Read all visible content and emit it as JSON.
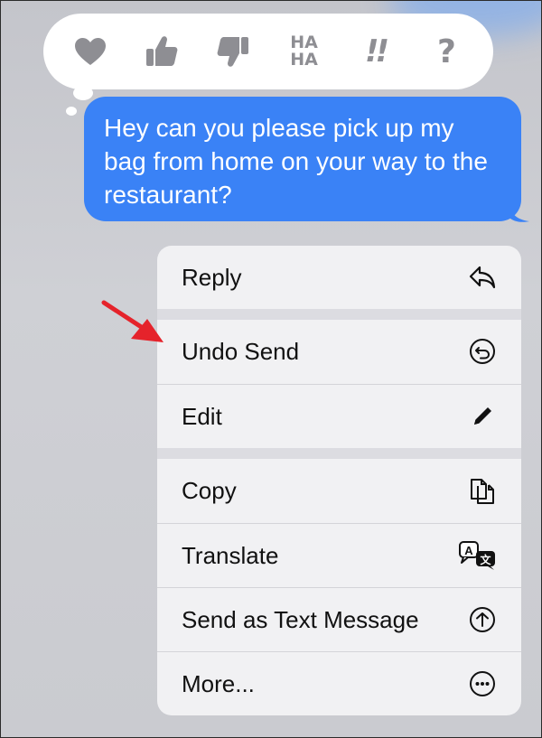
{
  "tapbacks": [
    {
      "name": "heart-icon"
    },
    {
      "name": "thumbs-up-icon"
    },
    {
      "name": "thumbs-down-icon"
    },
    {
      "name": "haha-icon",
      "line1": "HA",
      "line2": "HA"
    },
    {
      "name": "exclamation-icon",
      "text": "!!"
    },
    {
      "name": "question-icon",
      "text": "?"
    }
  ],
  "message": {
    "text": "Hey can you please pick up my bag from home on your way to the restaurant?"
  },
  "menu": {
    "items": [
      {
        "label": "Reply",
        "icon": "reply-icon"
      },
      {
        "label": "Undo Send",
        "icon": "undo-send-icon"
      },
      {
        "label": "Edit",
        "icon": "pencil-icon"
      },
      {
        "label": "Copy",
        "icon": "copy-icon"
      },
      {
        "label": "Translate",
        "icon": "translate-icon",
        "glyph_a": "A",
        "glyph_b": "文"
      },
      {
        "label": "Send as Text Message",
        "icon": "send-arrow-up-icon"
      },
      {
        "label": "More...",
        "icon": "more-icon"
      }
    ]
  },
  "colors": {
    "bubble": "#3a82f6",
    "menu_bg": "#f1f1f3",
    "annotation_arrow": "#e5232b",
    "tapback_icon": "#8e8e93"
  }
}
